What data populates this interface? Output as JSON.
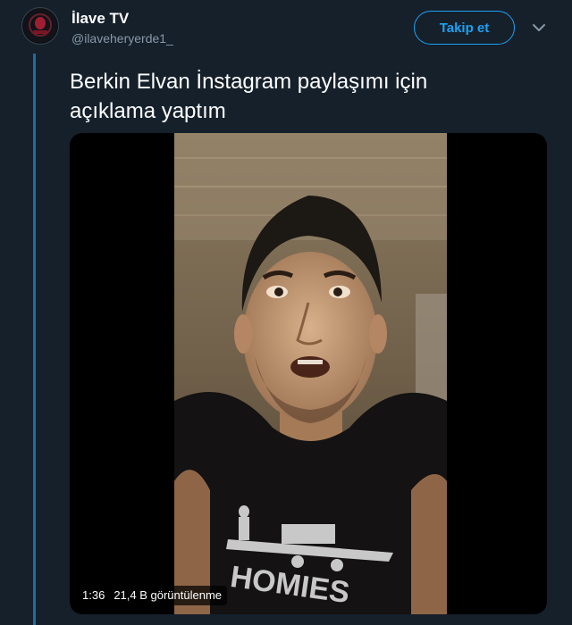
{
  "tweet": {
    "display_name": "İlave TV",
    "handle": "@ilaveheryerde1_",
    "follow_label": "Takip et",
    "text_line1": "Berkin Elvan İnstagram paylaşımı için",
    "text_line2": "açıklama yaptım"
  },
  "video": {
    "duration": "1:36",
    "views": "21,4 B görüntülenme"
  },
  "icons": {
    "avatar": "channel-logo",
    "more": "chevron-down-icon"
  },
  "colors": {
    "background": "#15202b",
    "accent": "#1da1f2",
    "secondary_text": "#8899a6",
    "thread_line": "#1c6ea4"
  }
}
